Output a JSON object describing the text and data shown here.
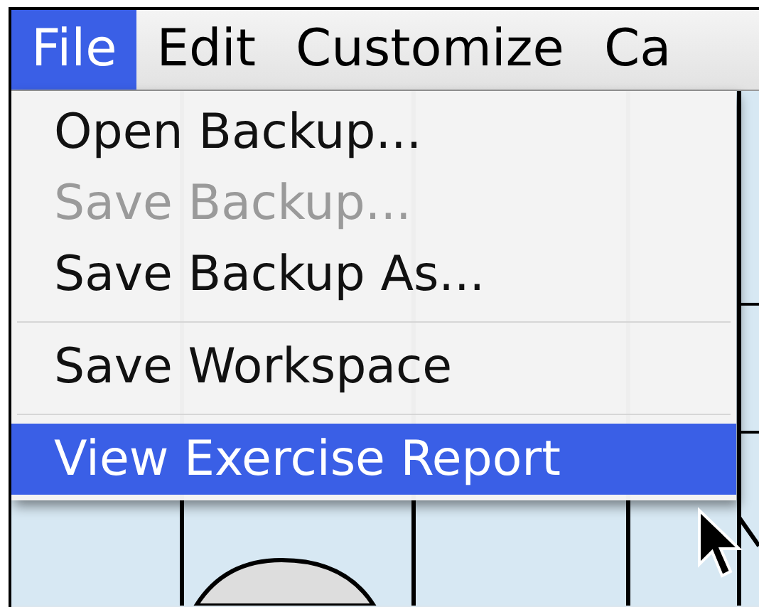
{
  "menu_bar": {
    "items": [
      {
        "label": "File",
        "selected": true
      },
      {
        "label": "Edit",
        "selected": false
      },
      {
        "label": "Customize",
        "selected": false
      },
      {
        "label": "Ca",
        "selected": false
      }
    ]
  },
  "menu": {
    "items": [
      {
        "kind": "item",
        "label": "Open Backup...",
        "disabled": false,
        "selected": false
      },
      {
        "kind": "item",
        "label": "Save Backup...",
        "disabled": true,
        "selected": false
      },
      {
        "kind": "item",
        "label": "Save Backup As...",
        "disabled": false,
        "selected": false
      },
      {
        "kind": "separator"
      },
      {
        "kind": "item",
        "label": "Save Workspace",
        "disabled": false,
        "selected": false
      },
      {
        "kind": "separator"
      },
      {
        "kind": "item",
        "label": "View Exercise Report",
        "disabled": false,
        "selected": true
      }
    ]
  }
}
